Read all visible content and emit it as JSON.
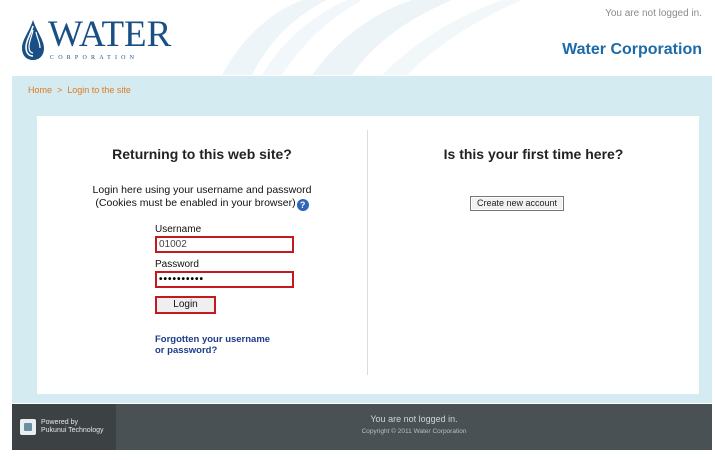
{
  "header": {
    "logo_word": "WATER",
    "logo_sub": "CORPORATION",
    "login_status": "You are not logged in.",
    "corp_name": "Water Corporation"
  },
  "breadcrumb": {
    "home": "Home",
    "separator": ">",
    "current": "Login to the site"
  },
  "login": {
    "heading": "Returning to this web site?",
    "intro_line1": "Login here using your username and password",
    "intro_line2": "(Cookies must be enabled in your browser)",
    "help_icon_glyph": "?",
    "username_label": "Username",
    "username_value": "01002",
    "password_label": "Password",
    "password_value": "••••••••••",
    "login_button": "Login",
    "forgot_line1": "Forgotten your username",
    "forgot_line2": "or password?"
  },
  "signup": {
    "heading": "Is this your first time here?",
    "create_button": "Create new account"
  },
  "footer": {
    "powered_line1": "Powered by",
    "powered_line2": "Pukunui Technology",
    "status": "You are not logged in.",
    "copyright": "Copyright © 2011 Water Corporation"
  },
  "colors": {
    "brand_blue": "#1a4f86",
    "accent_red": "#c41a1f",
    "breadcrumb_orange": "#e07a1c",
    "content_bg": "#d4ebf2",
    "footer_bg": "#4a5154"
  },
  "icons": {
    "logo": "water-drop-icon",
    "help": "help-icon",
    "footer_logo": "pukunui-logo-icon"
  }
}
